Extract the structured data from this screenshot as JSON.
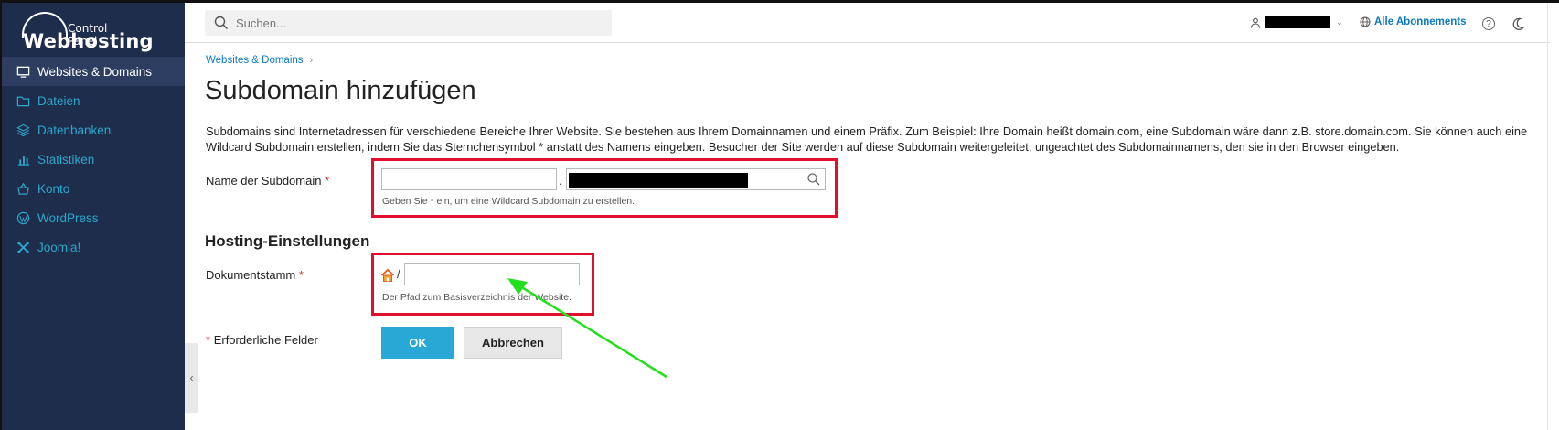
{
  "logo": {
    "subtitle": "Control Panel",
    "name": "Webhosting"
  },
  "sidebar": {
    "items": [
      {
        "label": "Websites & Domains",
        "icon": "monitor-icon",
        "active": true
      },
      {
        "label": "Dateien",
        "icon": "folder-icon",
        "active": false
      },
      {
        "label": "Datenbanken",
        "icon": "database-layers-icon",
        "active": false
      },
      {
        "label": "Statistiken",
        "icon": "bar-chart-icon",
        "active": false
      },
      {
        "label": "Konto",
        "icon": "account-basket-icon",
        "active": false
      },
      {
        "label": "WordPress",
        "icon": "wordpress-icon",
        "active": false
      },
      {
        "label": "Joomla!",
        "icon": "joomla-icon",
        "active": false
      }
    ],
    "collapse_glyph": "‹"
  },
  "topbar": {
    "search_placeholder": "Suchen...",
    "subscriptions_label": "Alle Abonnements",
    "help_glyph": "?"
  },
  "breadcrumb": {
    "item": "Websites & Domains",
    "separator": "›"
  },
  "page": {
    "title": "Subdomain hinzufügen",
    "description": "Subdomains sind Internetadressen für verschiedene Bereiche Ihrer Website. Sie bestehen aus Ihrem Domainnamen und einem Präfix. Zum Beispiel: Ihre Domain heißt domain.com, eine Subdomain wäre dann z.B. store.domain.com. Sie können auch eine Wildcard Subdomain erstellen, indem Sie das Sternchensymbol * anstatt des Namens eingeben. Besucher der Site werden auf diese Subdomain weitergeleitet, ungeachtet des Subdomainnamens, den sie in den Browser eingeben."
  },
  "form": {
    "subdomain": {
      "label": "Name der Subdomain",
      "required_mark": "*",
      "value": "",
      "separator": ".",
      "hint": "Geben Sie * ein, um eine Wildcard Subdomain zu erstellen."
    },
    "hosting_section": "Hosting-Einstellungen",
    "docroot": {
      "label": "Dokumentstamm",
      "required_mark": "*",
      "prefix": "/",
      "value": "",
      "hint": "Der Pfad zum Basisverzeichnis der Website."
    },
    "required_note_mark": "*",
    "required_note": "Erforderliche Felder",
    "ok_label": "OK",
    "cancel_label": "Abbrechen"
  },
  "colors": {
    "sidebar_bg": "#1f2d4d",
    "accent": "#28a9d5",
    "link": "#0b79c4",
    "highlight": "#e0102d",
    "annotation_arrow": "#22e01c"
  }
}
